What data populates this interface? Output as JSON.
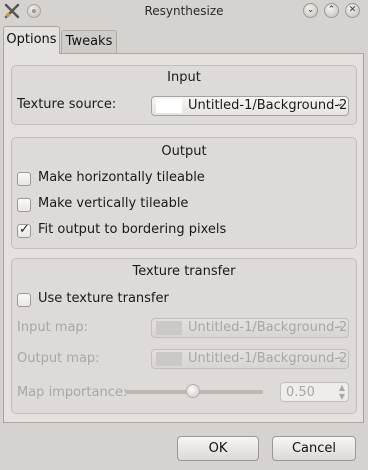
{
  "window": {
    "title": "Resynthesize",
    "icons": [
      "app-icon",
      "pin-icon",
      "minimize-icon",
      "maximize-icon",
      "close-icon"
    ]
  },
  "tabs": [
    {
      "label": "Options",
      "active": true
    },
    {
      "label": "Tweaks",
      "active": false
    }
  ],
  "input_group": {
    "title": "Input",
    "texture_source_label": "Texture source:",
    "texture_source_value": "Untitled-1/Background-2"
  },
  "output_group": {
    "title": "Output",
    "options": [
      {
        "label": "Make horizontally tileable",
        "checked": false
      },
      {
        "label": "Make vertically tileable",
        "checked": false
      },
      {
        "label": "Fit output to bordering pixels",
        "checked": true
      }
    ]
  },
  "transfer_group": {
    "title": "Texture transfer",
    "use_transfer_label": "Use texture transfer",
    "use_transfer_checked": false,
    "input_map_label": "Input map:",
    "input_map_value": "Untitled-1/Background-2",
    "output_map_label": "Output map:",
    "output_map_value": "Untitled-1/Background-2",
    "map_importance_label": "Map importance:",
    "map_importance_value": "0.50"
  },
  "buttons": {
    "ok": "OK",
    "cancel": "Cancel"
  }
}
